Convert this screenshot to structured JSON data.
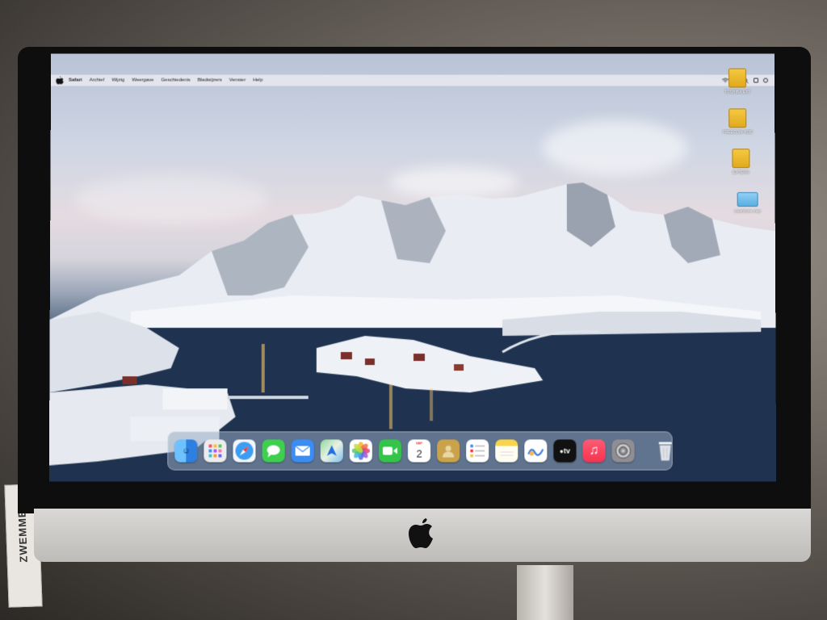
{
  "menubar": {
    "app_name": "Safari",
    "items": [
      "Archief",
      "Wijzig",
      "Weergave",
      "Geschiedenis",
      "Bladwijzers",
      "Venster",
      "Help"
    ]
  },
  "desktop_icons": [
    {
      "label": "TOSHIBA EXT",
      "icon": "drive-icon",
      "color": "#f0c040"
    },
    {
      "label": "FREECOM HDD",
      "icon": "drive-icon",
      "color": "#f0c040"
    },
    {
      "label": "EXTERN",
      "icon": "drive-icon",
      "color": "#f0c040"
    },
    {
      "label": "naamloze map",
      "icon": "folder-icon",
      "color": "#7cc3ee"
    }
  ],
  "dock": {
    "apps": [
      {
        "name": "Finder",
        "icon": "finder-icon",
        "color": "#3a8ff0"
      },
      {
        "name": "Launchpad",
        "icon": "launchpad-icon",
        "color": "#e8e8ec"
      },
      {
        "name": "Safari",
        "icon": "safari-icon",
        "color": "#3c9df2"
      },
      {
        "name": "Messages",
        "icon": "messages-icon",
        "color": "#3fcf4f"
      },
      {
        "name": "Mail",
        "icon": "mail-icon",
        "color": "#3a8df5"
      },
      {
        "name": "Maps",
        "icon": "maps-icon",
        "color": "#5cc26b"
      },
      {
        "name": "Photos",
        "icon": "photos-icon",
        "color": "#ffffff"
      },
      {
        "name": "FaceTime",
        "icon": "facetime-icon",
        "color": "#35c44a"
      },
      {
        "name": "Calendar",
        "icon": "calendar-icon",
        "color": "#ffffff",
        "month": "SEP",
        "day": "2"
      },
      {
        "name": "Contacts",
        "icon": "contacts-icon",
        "color": "#c9a24a"
      },
      {
        "name": "Reminders",
        "icon": "reminders-icon",
        "color": "#ffffff"
      },
      {
        "name": "Notes",
        "icon": "notes-icon",
        "color": "#f7e17a"
      },
      {
        "name": "Freeform",
        "icon": "freeform-icon",
        "color": "#ffffff"
      },
      {
        "name": "TV",
        "icon": "tv-icon",
        "color": "#111111",
        "label": "tv"
      },
      {
        "name": "Music",
        "icon": "music-icon",
        "color": "#f5435b"
      },
      {
        "name": "System Settings",
        "icon": "settings-icon",
        "color": "#8e8e93"
      }
    ],
    "trash": {
      "name": "Trash",
      "icon": "trash-icon"
    }
  },
  "hardware": {
    "side_note_text": "ZWEMMEN"
  }
}
